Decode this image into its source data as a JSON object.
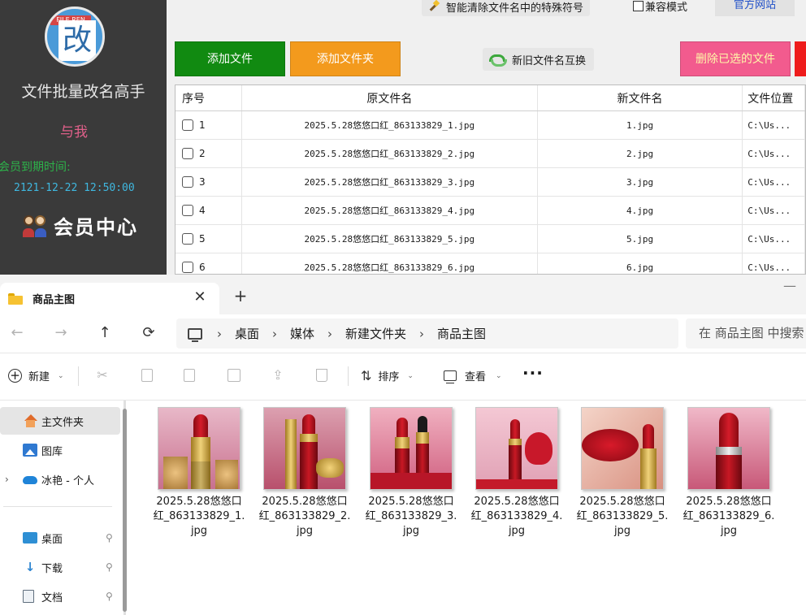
{
  "renamer": {
    "title": "文件批量改名高手",
    "logo_tag": "FILE REN",
    "logo_char": "改",
    "about": "与我",
    "member_label": "会员到期时间:",
    "member_date": "2121-12-22 12:50:00",
    "member_center": "会员中心",
    "clean_label": "智能清除文件名中的特殊符号",
    "compat_label": "兼容模式",
    "official_label": "官方网站",
    "add_file": "添加文件",
    "add_folder": "添加文件夹",
    "swap_label": "新旧文件名互换",
    "delete_label": "删除已选的文件",
    "columns": [
      "序号",
      "原文件名",
      "新文件名",
      "文件位置"
    ],
    "rows": [
      {
        "no": "1",
        "orig": "2025.5.28悠悠口红_863133829_1.jpg",
        "new": "1.jpg",
        "loc": "C:\\Us..."
      },
      {
        "no": "2",
        "orig": "2025.5.28悠悠口红_863133829_2.jpg",
        "new": "2.jpg",
        "loc": "C:\\Us..."
      },
      {
        "no": "3",
        "orig": "2025.5.28悠悠口红_863133829_3.jpg",
        "new": "3.jpg",
        "loc": "C:\\Us..."
      },
      {
        "no": "4",
        "orig": "2025.5.28悠悠口红_863133829_4.jpg",
        "new": "4.jpg",
        "loc": "C:\\Us..."
      },
      {
        "no": "5",
        "orig": "2025.5.28悠悠口红_863133829_5.jpg",
        "new": "5.jpg",
        "loc": "C:\\Us..."
      },
      {
        "no": "6",
        "orig": "2025.5.28悠悠口红_863133829_6.jpg",
        "new": "6.jpg",
        "loc": "C:\\Us..."
      }
    ]
  },
  "explorer": {
    "tab_title": "商品主图",
    "tab_close": "✕",
    "new_tab": "+",
    "minimize": "—",
    "nav_back": "←",
    "nav_forward": "→",
    "nav_up": "↑",
    "nav_refresh": "⟳",
    "breadcrumb": [
      "桌面",
      "媒体",
      "新建文件夹",
      "商品主图"
    ],
    "breadcrumb_sep": "›",
    "search_placeholder": "在 商品主图 中搜索",
    "toolbar": {
      "new_label": "新建",
      "sort_label": "排序",
      "view_label": "查看",
      "more_label": "···",
      "icons": [
        "cut-icon",
        "copy-icon",
        "paste-icon",
        "rename-icon",
        "share-icon",
        "delete-icon"
      ]
    },
    "nav": {
      "home": "主文件夹",
      "gallery": "图库",
      "onedrive": "冰艳 - 个人",
      "desktop": "桌面",
      "downloads": "下载",
      "documents": "文档"
    },
    "files": [
      {
        "name": "2025.5.28悠悠口红_863133829_1.jpg"
      },
      {
        "name": "2025.5.28悠悠口红_863133829_2.jpg"
      },
      {
        "name": "2025.5.28悠悠口红_863133829_3.jpg"
      },
      {
        "name": "2025.5.28悠悠口红_863133829_4.jpg"
      },
      {
        "name": "2025.5.28悠悠口红_863133829_5.jpg"
      },
      {
        "name": "2025.5.28悠悠口红_863133829_6.jpg"
      }
    ]
  },
  "colors": {
    "sidebar_bg": "#3a3a3a",
    "add_file": "#118a11",
    "add_folder": "#f39a1d",
    "delete": "#f25b8e",
    "member_green": "#2db34a",
    "member_date_blue": "#3fb8e0",
    "about_pink": "#e0608a",
    "lipstick_red": "#d41c2a"
  }
}
